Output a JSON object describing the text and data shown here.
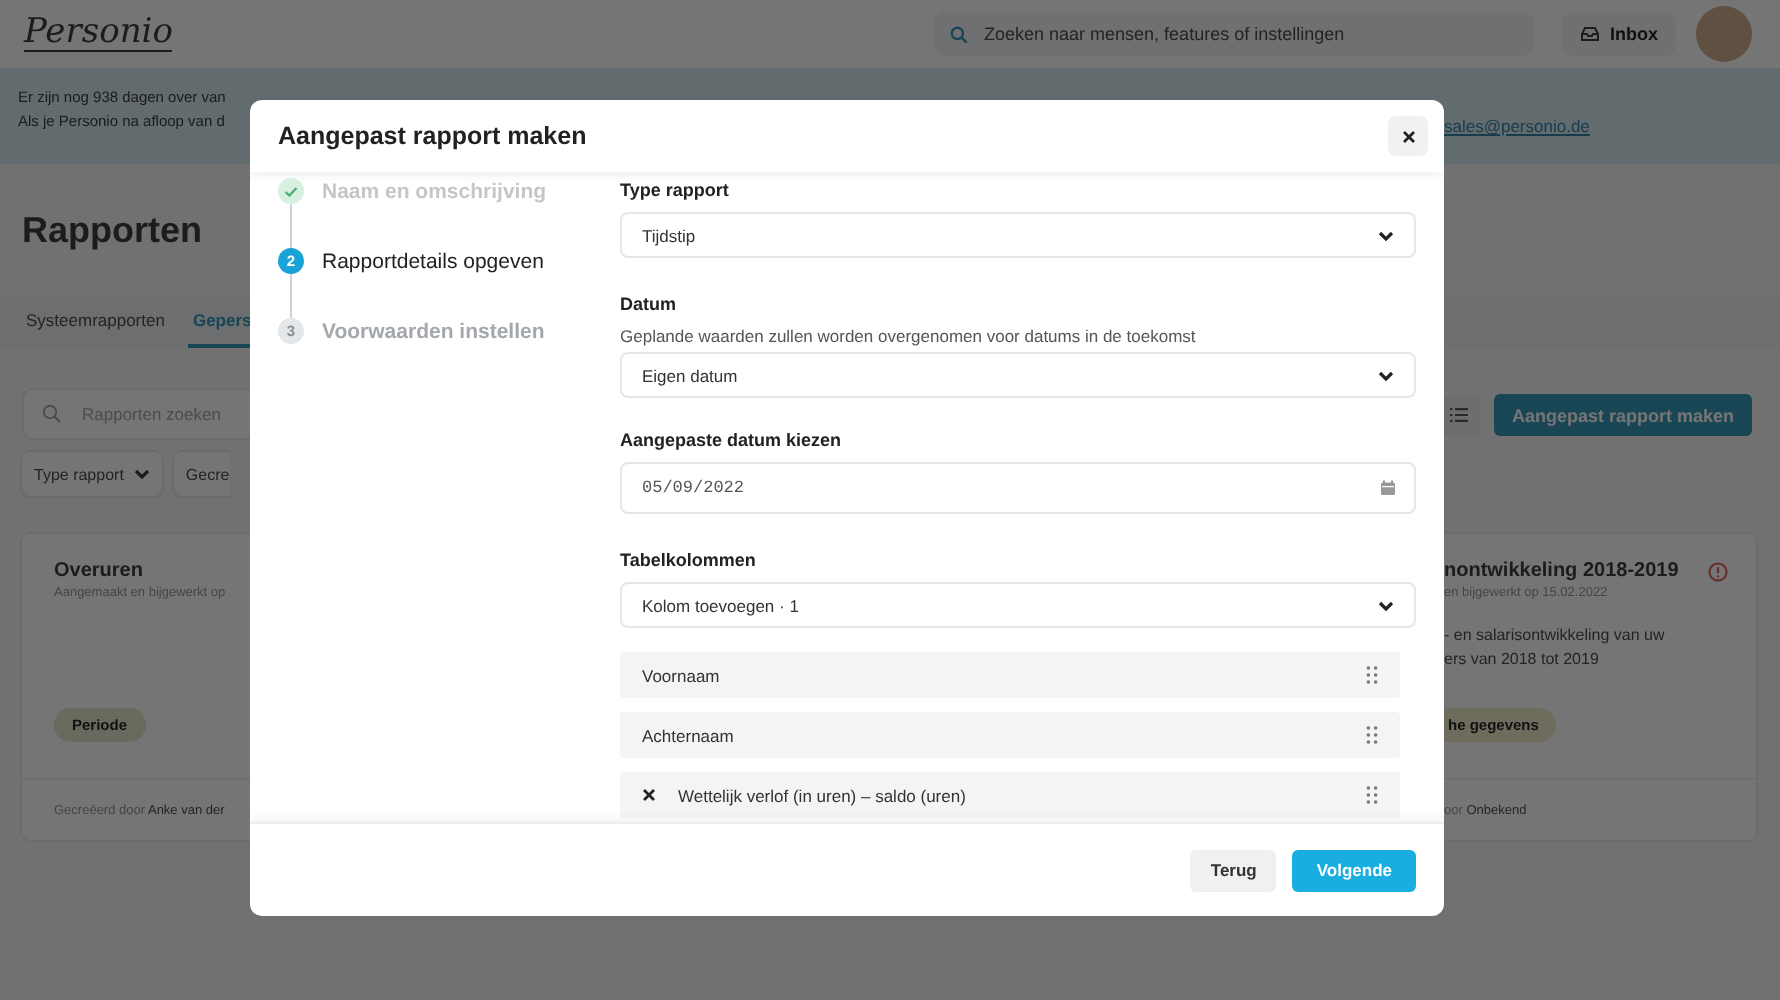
{
  "header": {
    "logo": "Personio",
    "search_placeholder": "Zoeken naar mensen, features of instellingen",
    "inbox": "Inbox"
  },
  "banner": {
    "line_1": "Er zijn nog 938 dagen over van",
    "line_2": "Als je Personio na afloop van d",
    "link": "sales@personio.de"
  },
  "page": {
    "title": "Rapporten",
    "tabs": [
      {
        "label": "Systeemrapporten",
        "selected": false
      },
      {
        "label": "Gepers",
        "selected": true
      }
    ],
    "search_placeholder": "Rapporten zoeken",
    "create_button": "Aangepast rapport maken",
    "filters": [
      {
        "label": "Type rapport",
        "kind": "dropdown"
      },
      {
        "label": "Gecre",
        "kind": "button"
      }
    ],
    "cards": [
      {
        "title": "Overuren",
        "subtitle": "Aangemaakt en bijgewerkt op",
        "tag": "Periode",
        "color": "#666b5e",
        "creator_label": "Gecreëerd door",
        "creator": "Anke van der"
      },
      {
        "title": "nontwikkeling 2018-2019",
        "warning": true,
        "subtitle": "en bijgewerkt op 15.02.2022",
        "description": [
          "- en salarisontwikkeling van uw",
          "ers van 2018 tot 2019"
        ],
        "tag": "he gegevens",
        "color": "#6d6c5d",
        "creator_label": "oor",
        "creator": "Onbekend"
      }
    ]
  },
  "dialog": {
    "title": "Aangepast rapport maken",
    "steps": [
      {
        "label": "Naam en omschrijving",
        "kind": "done"
      },
      {
        "number": "2",
        "label": "Rapportdetails opgeven",
        "kind": "current"
      },
      {
        "number": "3",
        "label": "Voorwaarden instellen",
        "kind": "upcoming"
      }
    ],
    "report_type": {
      "label": "Type rapport",
      "value": "Tijdstip"
    },
    "date": {
      "label": "Datum",
      "hint": "Geplande waarden zullen worden overgenomen voor datums in de toekomst",
      "value": "Eigen datum"
    },
    "custom_date": {
      "label": "Aangepaste datum kiezen",
      "value": "05/09/2022"
    },
    "columns": {
      "label": "Tabelkolommen",
      "add": "Kolom toevoegen · 1",
      "items": [
        {
          "label": "Voornaam",
          "removable": false
        },
        {
          "label": "Achternaam",
          "removable": false
        },
        {
          "label": "Wettelijk verlof (in uren) – saldo (uren)",
          "removable": true
        }
      ]
    },
    "buttons": {
      "back": "Terug",
      "next": "Volgende"
    }
  }
}
